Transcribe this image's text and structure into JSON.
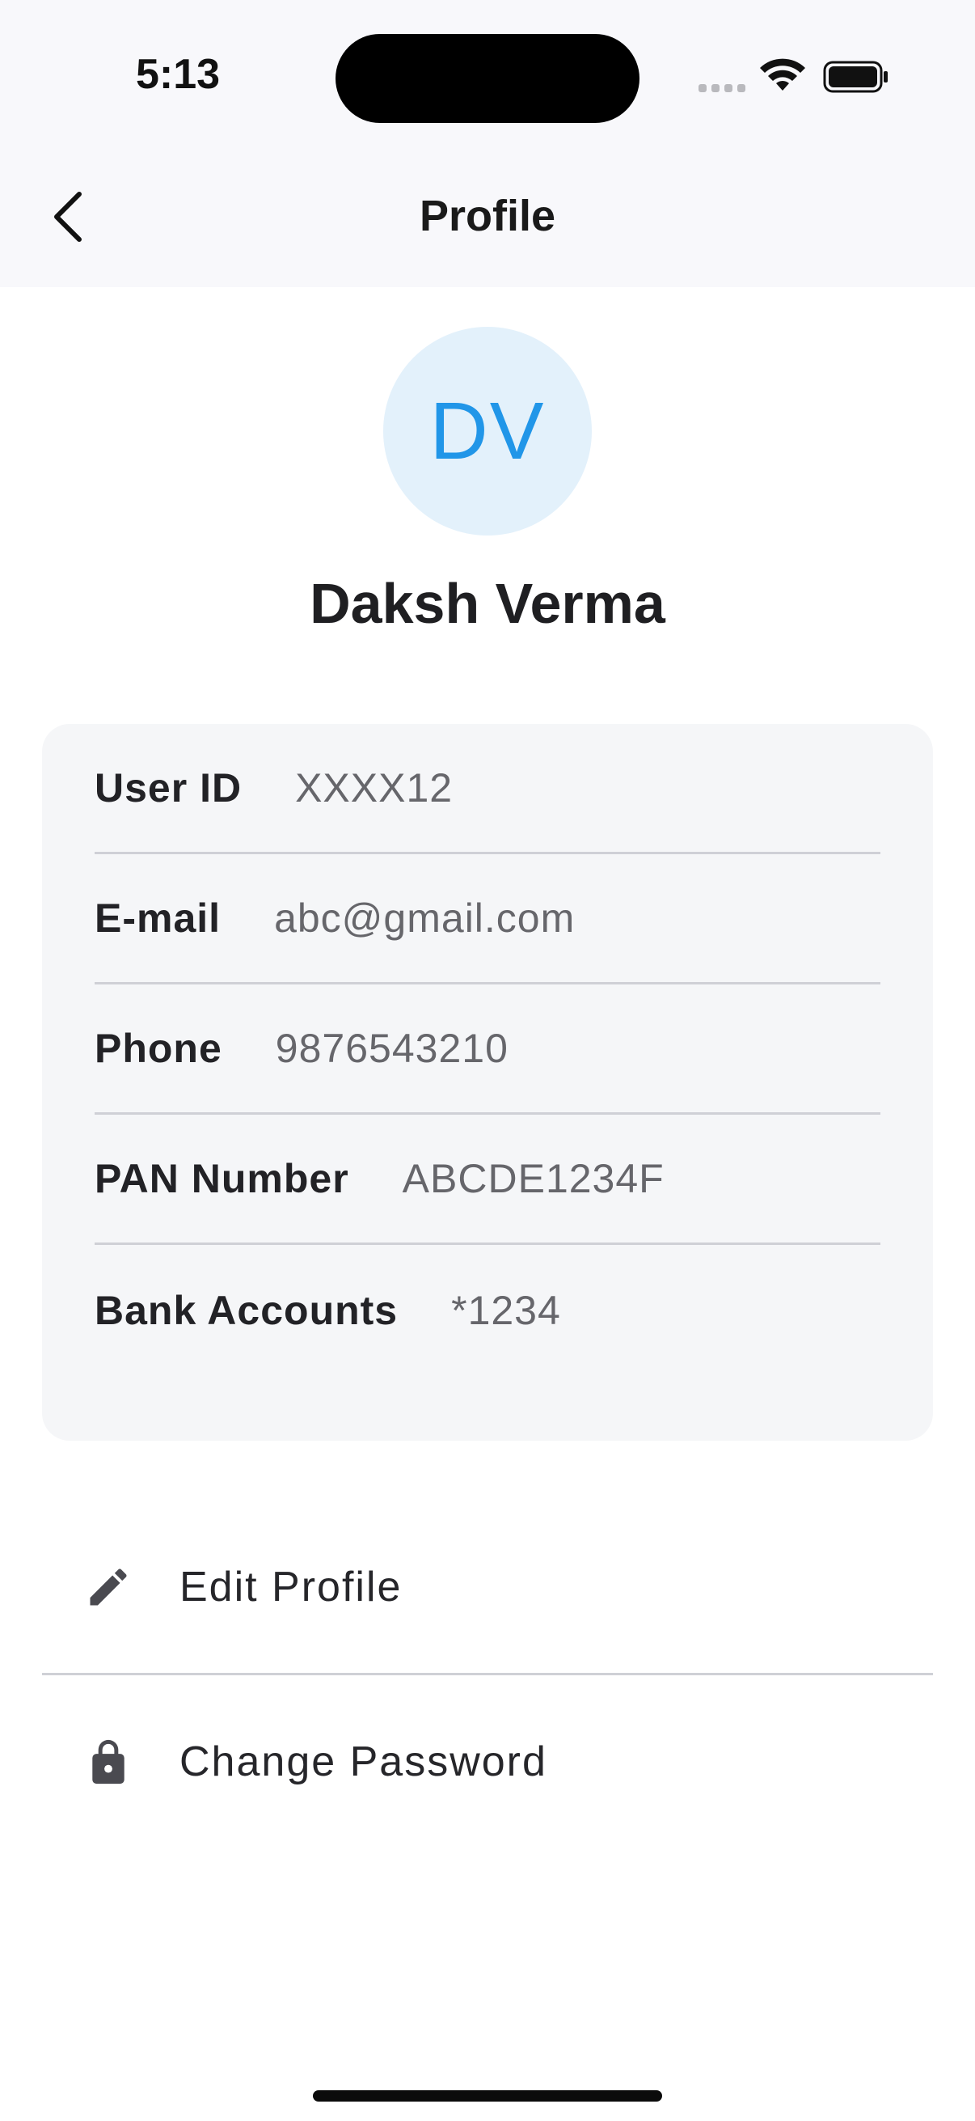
{
  "status_bar": {
    "time": "5:13"
  },
  "nav": {
    "title": "Profile"
  },
  "profile": {
    "initials": "DV",
    "name": "Daksh Verma"
  },
  "details": [
    {
      "label": "User ID",
      "value": "XXXX12"
    },
    {
      "label": "E-mail",
      "value": "abc@gmail.com"
    },
    {
      "label": "Phone",
      "value": "9876543210"
    },
    {
      "label": "PAN Number",
      "value": "ABCDE1234F"
    },
    {
      "label": "Bank Accounts",
      "value": "*1234"
    }
  ],
  "actions": {
    "edit_profile": {
      "label": "Edit Profile",
      "icon": "pencil-icon"
    },
    "change_password": {
      "label": "Change Password",
      "icon": "lock-icon"
    }
  },
  "colors": {
    "accent": "#2196e8",
    "avatar_bg": "#e3f1fb",
    "card_bg": "#f5f6f8"
  }
}
